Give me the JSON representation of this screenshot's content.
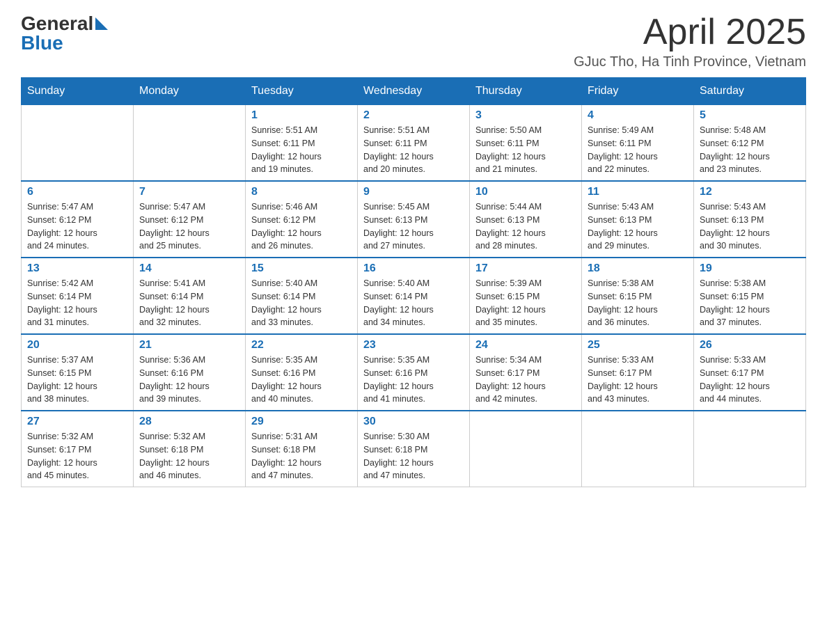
{
  "header": {
    "logo_general": "General",
    "logo_blue": "Blue",
    "month_title": "April 2025",
    "location": "GJuc Tho, Ha Tinh Province, Vietnam"
  },
  "weekdays": [
    "Sunday",
    "Monday",
    "Tuesday",
    "Wednesday",
    "Thursday",
    "Friday",
    "Saturday"
  ],
  "weeks": [
    [
      {
        "day": "",
        "info": ""
      },
      {
        "day": "",
        "info": ""
      },
      {
        "day": "1",
        "info": "Sunrise: 5:51 AM\nSunset: 6:11 PM\nDaylight: 12 hours\nand 19 minutes."
      },
      {
        "day": "2",
        "info": "Sunrise: 5:51 AM\nSunset: 6:11 PM\nDaylight: 12 hours\nand 20 minutes."
      },
      {
        "day": "3",
        "info": "Sunrise: 5:50 AM\nSunset: 6:11 PM\nDaylight: 12 hours\nand 21 minutes."
      },
      {
        "day": "4",
        "info": "Sunrise: 5:49 AM\nSunset: 6:11 PM\nDaylight: 12 hours\nand 22 minutes."
      },
      {
        "day": "5",
        "info": "Sunrise: 5:48 AM\nSunset: 6:12 PM\nDaylight: 12 hours\nand 23 minutes."
      }
    ],
    [
      {
        "day": "6",
        "info": "Sunrise: 5:47 AM\nSunset: 6:12 PM\nDaylight: 12 hours\nand 24 minutes."
      },
      {
        "day": "7",
        "info": "Sunrise: 5:47 AM\nSunset: 6:12 PM\nDaylight: 12 hours\nand 25 minutes."
      },
      {
        "day": "8",
        "info": "Sunrise: 5:46 AM\nSunset: 6:12 PM\nDaylight: 12 hours\nand 26 minutes."
      },
      {
        "day": "9",
        "info": "Sunrise: 5:45 AM\nSunset: 6:13 PM\nDaylight: 12 hours\nand 27 minutes."
      },
      {
        "day": "10",
        "info": "Sunrise: 5:44 AM\nSunset: 6:13 PM\nDaylight: 12 hours\nand 28 minutes."
      },
      {
        "day": "11",
        "info": "Sunrise: 5:43 AM\nSunset: 6:13 PM\nDaylight: 12 hours\nand 29 minutes."
      },
      {
        "day": "12",
        "info": "Sunrise: 5:43 AM\nSunset: 6:13 PM\nDaylight: 12 hours\nand 30 minutes."
      }
    ],
    [
      {
        "day": "13",
        "info": "Sunrise: 5:42 AM\nSunset: 6:14 PM\nDaylight: 12 hours\nand 31 minutes."
      },
      {
        "day": "14",
        "info": "Sunrise: 5:41 AM\nSunset: 6:14 PM\nDaylight: 12 hours\nand 32 minutes."
      },
      {
        "day": "15",
        "info": "Sunrise: 5:40 AM\nSunset: 6:14 PM\nDaylight: 12 hours\nand 33 minutes."
      },
      {
        "day": "16",
        "info": "Sunrise: 5:40 AM\nSunset: 6:14 PM\nDaylight: 12 hours\nand 34 minutes."
      },
      {
        "day": "17",
        "info": "Sunrise: 5:39 AM\nSunset: 6:15 PM\nDaylight: 12 hours\nand 35 minutes."
      },
      {
        "day": "18",
        "info": "Sunrise: 5:38 AM\nSunset: 6:15 PM\nDaylight: 12 hours\nand 36 minutes."
      },
      {
        "day": "19",
        "info": "Sunrise: 5:38 AM\nSunset: 6:15 PM\nDaylight: 12 hours\nand 37 minutes."
      }
    ],
    [
      {
        "day": "20",
        "info": "Sunrise: 5:37 AM\nSunset: 6:15 PM\nDaylight: 12 hours\nand 38 minutes."
      },
      {
        "day": "21",
        "info": "Sunrise: 5:36 AM\nSunset: 6:16 PM\nDaylight: 12 hours\nand 39 minutes."
      },
      {
        "day": "22",
        "info": "Sunrise: 5:35 AM\nSunset: 6:16 PM\nDaylight: 12 hours\nand 40 minutes."
      },
      {
        "day": "23",
        "info": "Sunrise: 5:35 AM\nSunset: 6:16 PM\nDaylight: 12 hours\nand 41 minutes."
      },
      {
        "day": "24",
        "info": "Sunrise: 5:34 AM\nSunset: 6:17 PM\nDaylight: 12 hours\nand 42 minutes."
      },
      {
        "day": "25",
        "info": "Sunrise: 5:33 AM\nSunset: 6:17 PM\nDaylight: 12 hours\nand 43 minutes."
      },
      {
        "day": "26",
        "info": "Sunrise: 5:33 AM\nSunset: 6:17 PM\nDaylight: 12 hours\nand 44 minutes."
      }
    ],
    [
      {
        "day": "27",
        "info": "Sunrise: 5:32 AM\nSunset: 6:17 PM\nDaylight: 12 hours\nand 45 minutes."
      },
      {
        "day": "28",
        "info": "Sunrise: 5:32 AM\nSunset: 6:18 PM\nDaylight: 12 hours\nand 46 minutes."
      },
      {
        "day": "29",
        "info": "Sunrise: 5:31 AM\nSunset: 6:18 PM\nDaylight: 12 hours\nand 47 minutes."
      },
      {
        "day": "30",
        "info": "Sunrise: 5:30 AM\nSunset: 6:18 PM\nDaylight: 12 hours\nand 47 minutes."
      },
      {
        "day": "",
        "info": ""
      },
      {
        "day": "",
        "info": ""
      },
      {
        "day": "",
        "info": ""
      }
    ]
  ]
}
